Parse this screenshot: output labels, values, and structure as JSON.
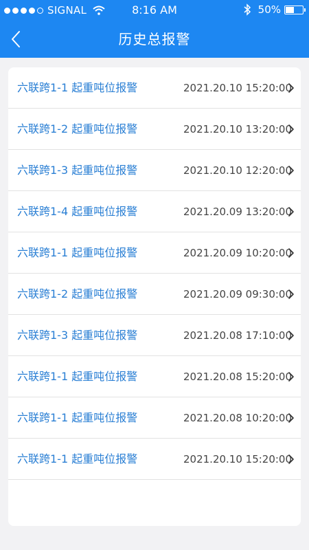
{
  "status_bar": {
    "carrier": "SIGNAL",
    "time": "8:16 AM",
    "battery_text": "50%",
    "battery_level": 0.5,
    "signal_bars_filled": 4,
    "signal_bars_total": 5
  },
  "nav": {
    "title": "历史总报警",
    "back_icon": "chevron-left-icon"
  },
  "theme": {
    "primary": "#1d87f2",
    "link": "#2a7fd4",
    "background": "#f2f2f4"
  },
  "alarms": [
    {
      "title": "六联跨1-1 起重吨位报警",
      "time": "2021.20.10 15:20:00"
    },
    {
      "title": "六联跨1-2 起重吨位报警",
      "time": "2021.20.10 13:20:00"
    },
    {
      "title": "六联跨1-3 起重吨位报警",
      "time": "2021.20.10 12:20:00"
    },
    {
      "title": "六联跨1-4 起重吨位报警",
      "time": "2021.20.09 13:20:00"
    },
    {
      "title": "六联跨1-1 起重吨位报警",
      "time": "2021.20.09 10:20:00"
    },
    {
      "title": "六联跨1-2 起重吨位报警",
      "time": "2021.20.09 09:30:00"
    },
    {
      "title": "六联跨1-3 起重吨位报警",
      "time": "2021.20.08 17:10:00"
    },
    {
      "title": "六联跨1-1 起重吨位报警",
      "time": "2021.20.08 15:20:00"
    },
    {
      "title": "六联跨1-1 起重吨位报警",
      "time": "2021.20.08 10:20:00"
    },
    {
      "title": "六联跨1-1 起重吨位报警",
      "time": "2021.20.10 15:20:00"
    }
  ]
}
